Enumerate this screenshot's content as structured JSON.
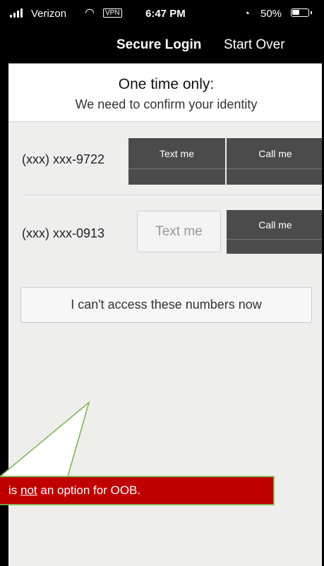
{
  "status_bar": {
    "carrier": "Verizon",
    "vpn": "VPN",
    "time": "6:47 PM",
    "battery_percent": "50%",
    "battery_level": 0.5,
    "icons": [
      "signal-icon",
      "wifi-icon",
      "vpn-icon",
      "alarm-icon",
      "battery-icon"
    ]
  },
  "nav": {
    "title": "Secure Login",
    "start_over": "Start Over"
  },
  "header": {
    "title": "One time only:",
    "subtitle": "We need to confirm your identity"
  },
  "phones": [
    {
      "number": "(xxx) xxx-9722",
      "text_label": "Text me",
      "call_label": "Call me"
    },
    {
      "number": "(xxx) xxx-0913",
      "text_label": "Text me",
      "call_label": "Call me"
    }
  ],
  "access_button": "I can't access these numbers now",
  "callout": {
    "prefix": "is ",
    "emphasis": "not",
    "suffix": " an option for OOB."
  },
  "colors": {
    "accent_dark": "#4b4b4b",
    "banner": "#c00000",
    "callout_border": "#7bb24d"
  }
}
